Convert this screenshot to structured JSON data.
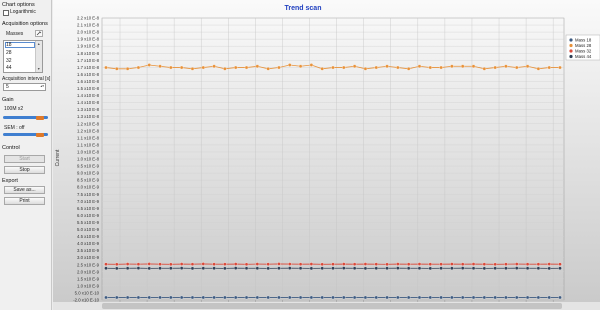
{
  "sidebar": {
    "chart_options_label": "Chart options",
    "logarithmic_label": "Logarithmic",
    "logarithmic_checked": false,
    "acquisition_options_label": "Acquisition options",
    "masses_label": "Masses",
    "masses": [
      "18",
      "28",
      "32",
      "44"
    ],
    "selected_mass": "18",
    "interval_label": "Acquisition interval [s]",
    "interval_value": "5",
    "gain_label": "Gain",
    "gain_value_label": "100M x2",
    "gain_level": 0.82,
    "sem_label": "SEM : off",
    "sem_level": 0.82,
    "control_label": "Control",
    "start_label": "Start",
    "stop_label": "Stop",
    "export_label": "Export",
    "save_label": "Save as...",
    "print_label": "Print"
  },
  "chart_data": {
    "type": "line",
    "title": "Trend scan",
    "ylabel": "Current",
    "xlabel": "",
    "ylim": [
      -2e-10,
      2.2e-08
    ],
    "y_ticks": [
      "2.2 x10 E-8",
      "2.1 x10 E-8",
      "2.0 x10 E-8",
      "1.9 x10 E-8",
      "1.9 x10 E-8",
      "1.8 x10 E-8",
      "1.7 x10 E-8",
      "1.7 x10 E-8",
      "1.6 x10 E-8",
      "1.6 x10 E-8",
      "1.5 x10 E-8",
      "1.4 x10 E-8",
      "1.4 x10 E-8",
      "1.3 x10 E-8",
      "1.3 x10 E-8",
      "1.2 x10 E-8",
      "1.2 x10 E-8",
      "1.1 x10 E-8",
      "1.1 x10 E-8",
      "1.0 x10 E-8",
      "1.0 x10 E-8",
      "9.5 x10 E-9",
      "9.0 x10 E-9",
      "8.5 x10 E-9",
      "8.0 x10 E-9",
      "7.5 x10 E-9",
      "7.0 x10 E-9",
      "6.5 x10 E-9",
      "6.0 x10 E-9",
      "5.5 x10 E-9",
      "5.0 x10 E-9",
      "4.5 x10 E-9",
      "4.0 x10 E-9",
      "3.5 x10 E-9",
      "3.0 x10 E-9",
      "2.5 x10 E-9",
      "2.0 x10 E-9",
      "1.5 x10 E-9",
      "1.0 x10 E-9",
      "5.0 x10 E-10",
      "-2.0 x10 E-10"
    ],
    "x_tick_count": 17,
    "legend_position": "top-right",
    "grid": true,
    "series": [
      {
        "name": "Mass 18",
        "color": "#3d5a80",
        "values": [
          0,
          0,
          0,
          0,
          0,
          0,
          0,
          0,
          0,
          0,
          0,
          0,
          0,
          0,
          0,
          0,
          0,
          0,
          0,
          0,
          0,
          0,
          0,
          0,
          0,
          0,
          0,
          0,
          0,
          0,
          0,
          0,
          0,
          0,
          0,
          0,
          0,
          0,
          0,
          0,
          0,
          0,
          0
        ]
      },
      {
        "name": "Mass 28",
        "color": "#e8923a",
        "values": [
          1.81e-08,
          1.8e-08,
          1.8e-08,
          1.81e-08,
          1.83e-08,
          1.82e-08,
          1.81e-08,
          1.81e-08,
          1.8e-08,
          1.81e-08,
          1.82e-08,
          1.8e-08,
          1.81e-08,
          1.81e-08,
          1.82e-08,
          1.8e-08,
          1.81e-08,
          1.83e-08,
          1.82e-08,
          1.83e-08,
          1.8e-08,
          1.81e-08,
          1.81e-08,
          1.82e-08,
          1.8e-08,
          1.81e-08,
          1.82e-08,
          1.81e-08,
          1.8e-08,
          1.82e-08,
          1.81e-08,
          1.81e-08,
          1.82e-08,
          1.82e-08,
          1.82e-08,
          1.8e-08,
          1.81e-08,
          1.82e-08,
          1.81e-08,
          1.82e-08,
          1.8e-08,
          1.81e-08,
          1.81e-08
        ]
      },
      {
        "name": "Mass 32",
        "color": "#d94a3a",
        "values": [
          2.62e-09,
          2.61e-09,
          2.63e-09,
          2.62e-09,
          2.64e-09,
          2.62e-09,
          2.61e-09,
          2.63e-09,
          2.62e-09,
          2.64e-09,
          2.62e-09,
          2.62e-09,
          2.63e-09,
          2.61e-09,
          2.63e-09,
          2.62e-09,
          2.64e-09,
          2.63e-09,
          2.62e-09,
          2.63e-09,
          2.61e-09,
          2.62e-09,
          2.63e-09,
          2.62e-09,
          2.63e-09,
          2.62e-09,
          2.61e-09,
          2.63e-09,
          2.62e-09,
          2.63e-09,
          2.62e-09,
          2.62e-09,
          2.63e-09,
          2.62e-09,
          2.63e-09,
          2.62e-09,
          2.61e-09,
          2.62e-09,
          2.63e-09,
          2.62e-09,
          2.62e-09,
          2.63e-09,
          2.62e-09
        ]
      },
      {
        "name": "Mass 44",
        "color": "#2f3f55",
        "values": [
          2.3e-09,
          2.29e-09,
          2.3e-09,
          2.31e-09,
          2.29e-09,
          2.3e-09,
          2.3e-09,
          2.31e-09,
          2.29e-09,
          2.3e-09,
          2.3e-09,
          2.29e-09,
          2.31e-09,
          2.3e-09,
          2.3e-09,
          2.29e-09,
          2.3e-09,
          2.31e-09,
          2.3e-09,
          2.29e-09,
          2.3e-09,
          2.3e-09,
          2.31e-09,
          2.3e-09,
          2.29e-09,
          2.3e-09,
          2.3e-09,
          2.31e-09,
          2.3e-09,
          2.3e-09,
          2.29e-09,
          2.3e-09,
          2.3e-09,
          2.31e-09,
          2.3e-09,
          2.29e-09,
          2.3e-09,
          2.3e-09,
          2.31e-09,
          2.3e-09,
          2.3e-09,
          2.29e-09,
          2.3e-09
        ]
      }
    ]
  }
}
